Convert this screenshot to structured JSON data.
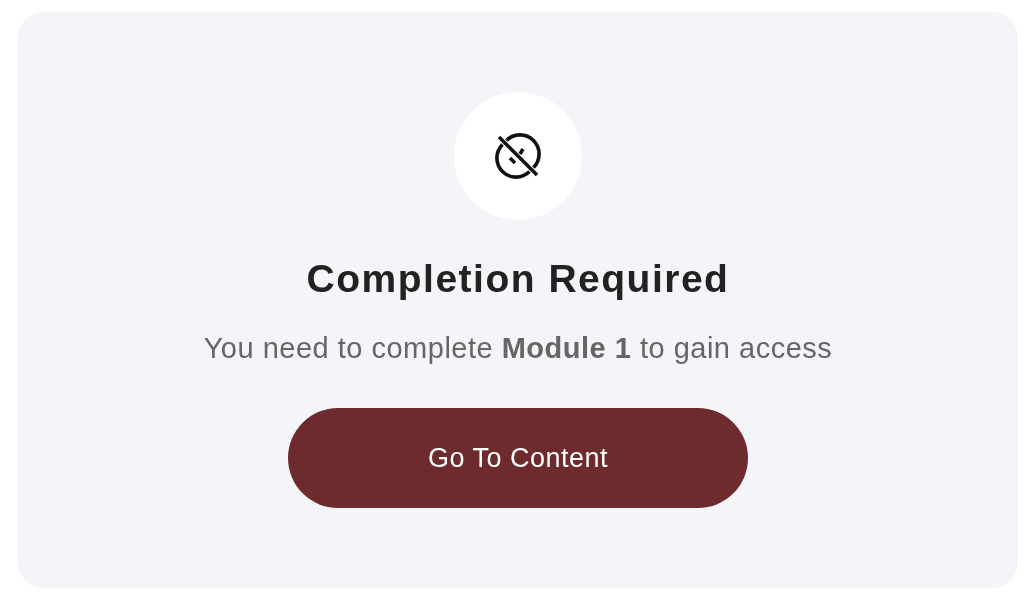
{
  "title": "Completion Required",
  "message": "You need to complete **Module 1** to gain access",
  "button": {
    "label": "Go To Content"
  }
}
